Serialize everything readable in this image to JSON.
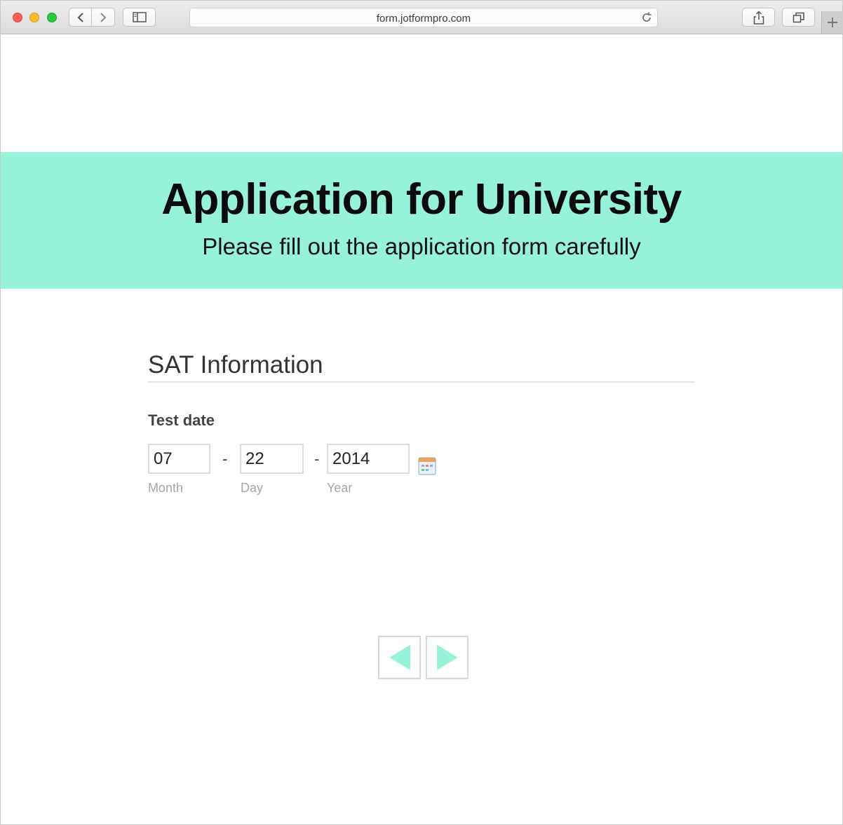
{
  "browser": {
    "url": "form.jotformpro.com"
  },
  "form": {
    "title": "Application for University",
    "subtitle": "Please fill out the application form carefully"
  },
  "section": {
    "heading": "SAT Information",
    "field_label": "Test date",
    "date": {
      "month_value": "07",
      "day_value": "22",
      "year_value": "2014",
      "separator": "-",
      "month_label": "Month",
      "day_label": "Day",
      "year_label": "Year"
    }
  },
  "colors": {
    "accent": "#96f2d9",
    "arrow": "#96f2d9"
  },
  "icons": {
    "calendar": "calendar-icon",
    "prev": "prev-arrow-icon",
    "next": "next-arrow-icon"
  }
}
